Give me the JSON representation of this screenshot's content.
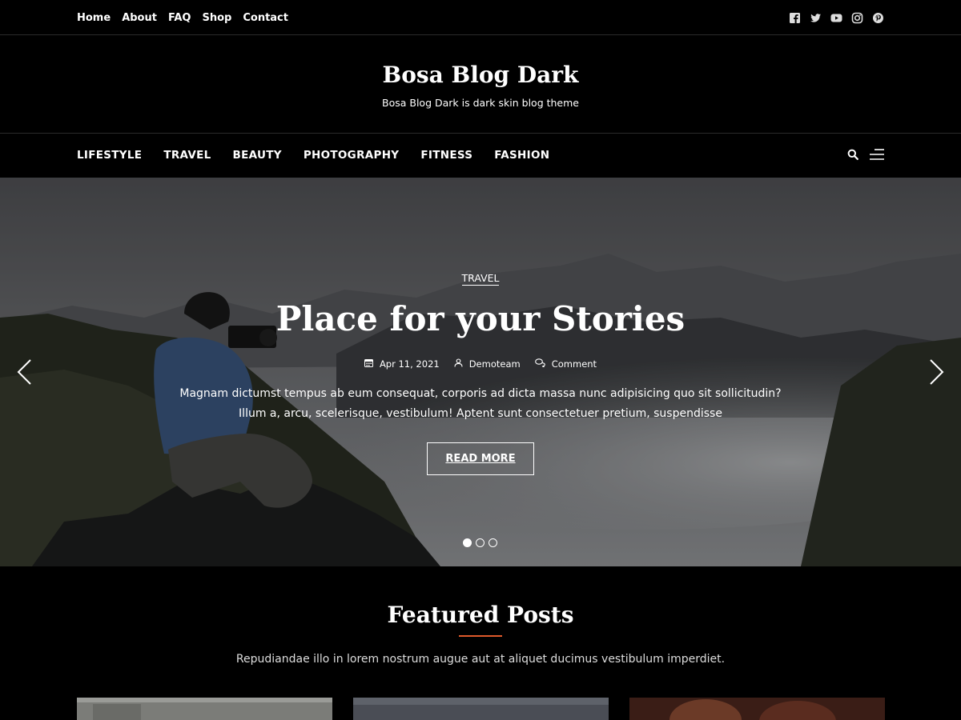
{
  "top_nav": {
    "links": [
      "Home",
      "About",
      "FAQ",
      "Shop",
      "Contact"
    ],
    "social_icons": [
      "facebook-icon",
      "twitter-icon",
      "youtube-icon",
      "instagram-icon",
      "pinterest-icon"
    ]
  },
  "branding": {
    "title": "Bosa Blog Dark",
    "description": "Bosa Blog Dark is dark skin blog theme"
  },
  "main_nav": {
    "items": [
      "LIFESTYLE",
      "TRAVEL",
      "BEAUTY",
      "PHOTOGRAPHY",
      "FITNESS",
      "FASHION"
    ],
    "icons": [
      "search-icon",
      "hamburger-menu-icon"
    ]
  },
  "hero": {
    "category": "TRAVEL",
    "title": "Place for your Stories",
    "date": "Apr 11, 2021",
    "author": "Demoteam",
    "comment": "Comment",
    "excerpt": "Magnam dictumst tempus ab eum consequat, corporis ad dicta massa nunc adipisicing quo sit sollicitudin? Illum a, arcu, scelerisque, vestibulum! Aptent sunt consectetuer pretium, suspendisse",
    "button": "READ MORE",
    "slide_count": 3,
    "active_slide": 1
  },
  "featured": {
    "title": "Featured Posts",
    "subtitle": "Repudiandae illo in lorem nostrum augue aut at aliquet ducimus vestibulum imperdiet."
  },
  "colors": {
    "background": "#000000",
    "accent": "#e05a2b",
    "text": "#ffffff"
  }
}
